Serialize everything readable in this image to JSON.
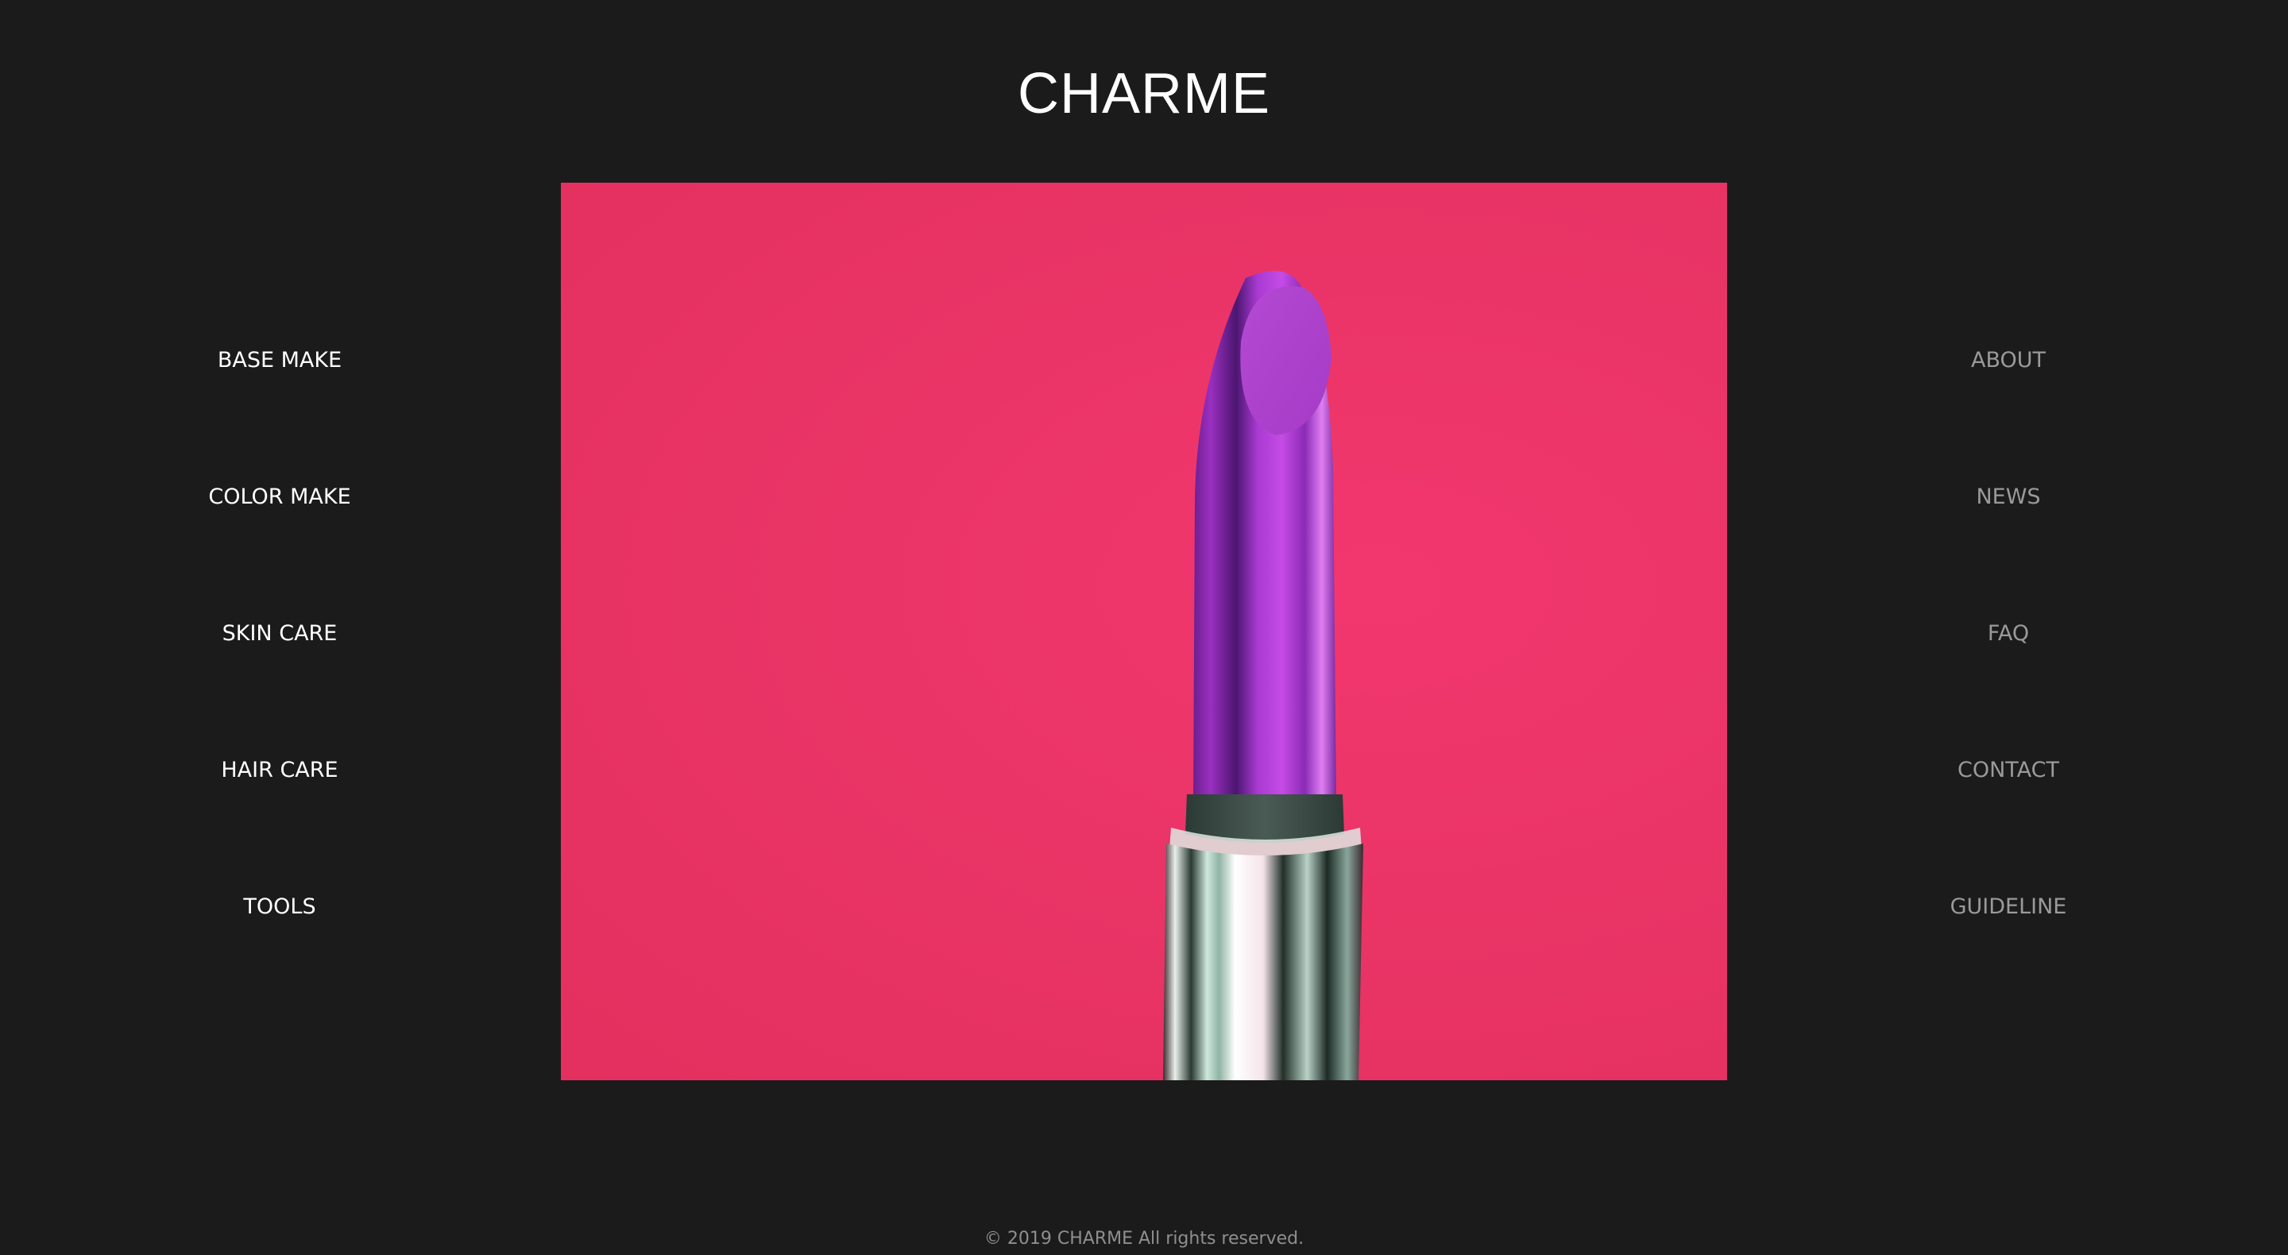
{
  "brand": {
    "name": "CHARME"
  },
  "hero": {
    "image": "lipstick-photo",
    "colors": {
      "background": "#ea3467",
      "lipstick": "#b03ad0",
      "tube": "#c9d2cc"
    }
  },
  "nav_left": {
    "items": [
      {
        "label": "BASE MAKE"
      },
      {
        "label": "COLOR MAKE"
      },
      {
        "label": "SKIN CARE"
      },
      {
        "label": "HAIR CARE"
      },
      {
        "label": "TOOLS"
      }
    ]
  },
  "nav_right": {
    "items": [
      {
        "label": "ABOUT"
      },
      {
        "label": "NEWS"
      },
      {
        "label": "FAQ"
      },
      {
        "label": "CONTACT"
      },
      {
        "label": "GUIDELINE"
      }
    ]
  },
  "footer": {
    "copyright": "© 2019 CHARME All rights reserved."
  },
  "theme": {
    "page_background": "#1b1b1b",
    "primary_text": "#ffffff",
    "secondary_text": "#9a9a9a"
  }
}
